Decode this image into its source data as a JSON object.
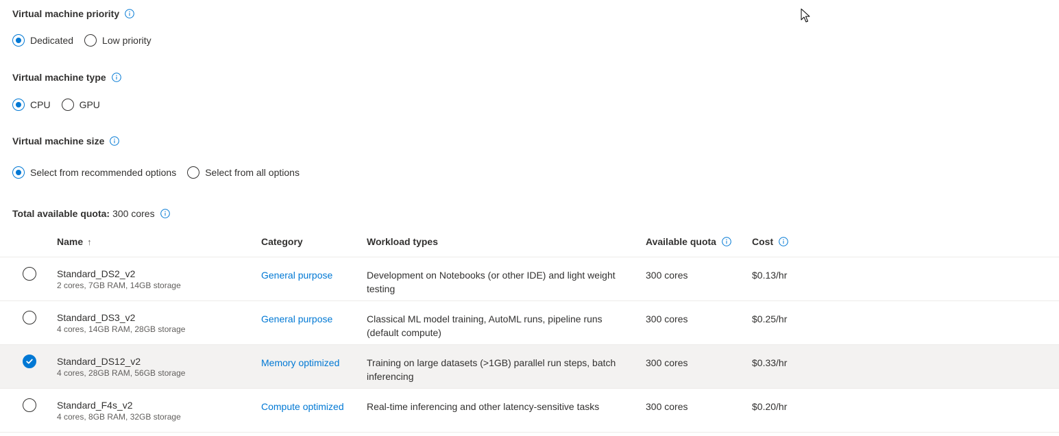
{
  "vm_priority": {
    "label": "Virtual machine priority",
    "options": [
      "Dedicated",
      "Low priority"
    ],
    "selected": "Dedicated"
  },
  "vm_type": {
    "label": "Virtual machine type",
    "options": [
      "CPU",
      "GPU"
    ],
    "selected": "CPU"
  },
  "vm_size": {
    "label": "Virtual machine size",
    "options": [
      "Select from recommended options",
      "Select from all options"
    ],
    "selected": "Select from recommended options"
  },
  "quota": {
    "label": "Total available quota:",
    "value": "300 cores"
  },
  "table": {
    "headers": {
      "name": "Name",
      "name_sort": "↑",
      "category": "Category",
      "workload": "Workload types",
      "available_quota": "Available quota",
      "cost": "Cost"
    },
    "rows": [
      {
        "name": "Standard_DS2_v2",
        "specs": "2 cores, 7GB RAM, 14GB storage",
        "category": "General purpose",
        "workload": "Development on Notebooks (or other IDE) and light weight testing",
        "quota": "300 cores",
        "cost": "$0.13/hr",
        "selected": false
      },
      {
        "name": "Standard_DS3_v2",
        "specs": "4 cores, 14GB RAM, 28GB storage",
        "category": "General purpose",
        "workload": "Classical ML model training, AutoML runs, pipeline runs (default compute)",
        "quota": "300 cores",
        "cost": "$0.25/hr",
        "selected": false
      },
      {
        "name": "Standard_DS12_v2",
        "specs": "4 cores, 28GB RAM, 56GB storage",
        "category": "Memory optimized",
        "workload": "Training on large datasets (>1GB) parallel run steps, batch inferencing",
        "quota": "300 cores",
        "cost": "$0.33/hr",
        "selected": true
      },
      {
        "name": "Standard_F4s_v2",
        "specs": "4 cores, 8GB RAM, 32GB storage",
        "category": "Compute optimized",
        "workload": "Real-time inferencing and other latency-sensitive tasks",
        "quota": "300 cores",
        "cost": "$0.20/hr",
        "selected": false
      }
    ]
  },
  "colors": {
    "accent": "#0078d4",
    "text": "#323130",
    "subtext": "#605e5c",
    "selected_row": "#f3f2f1",
    "divider": "#edebe9"
  }
}
